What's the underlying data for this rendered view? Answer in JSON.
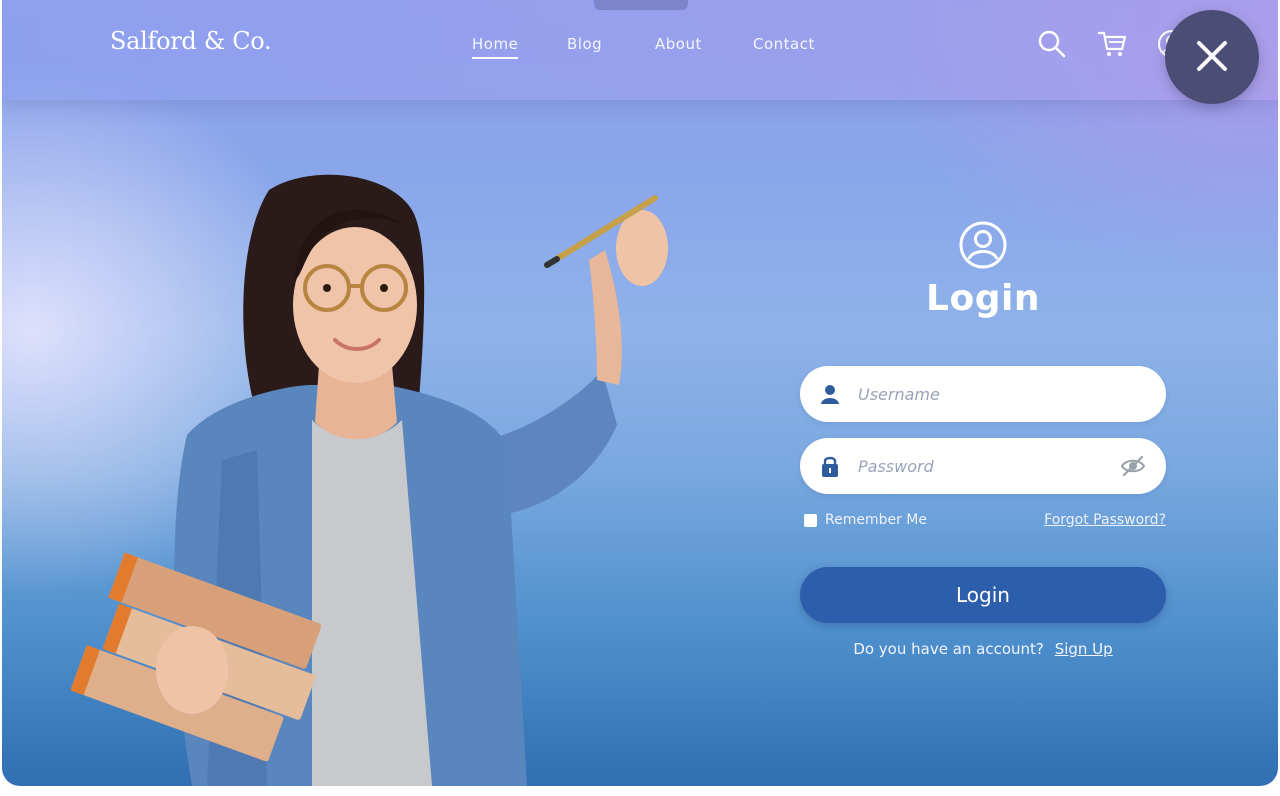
{
  "brand": {
    "name": "Salford & Co."
  },
  "nav": {
    "links": [
      {
        "label": "Home",
        "active": true
      },
      {
        "label": "Blog",
        "active": false
      },
      {
        "label": "About",
        "active": false
      },
      {
        "label": "Contact",
        "active": false
      }
    ],
    "icons": [
      "search-icon",
      "cart-icon",
      "account-icon"
    ]
  },
  "login": {
    "title": "Login",
    "username_placeholder": "Username",
    "password_placeholder": "Password",
    "remember_label": "Remember Me",
    "forgot_label": "Forgot Password?",
    "button_label": "Login",
    "signup_prompt": "Do you have an account?",
    "signup_label": "Sign Up"
  },
  "colors": {
    "login_button": "#2d5eab",
    "close_button": "#4c4d74"
  }
}
